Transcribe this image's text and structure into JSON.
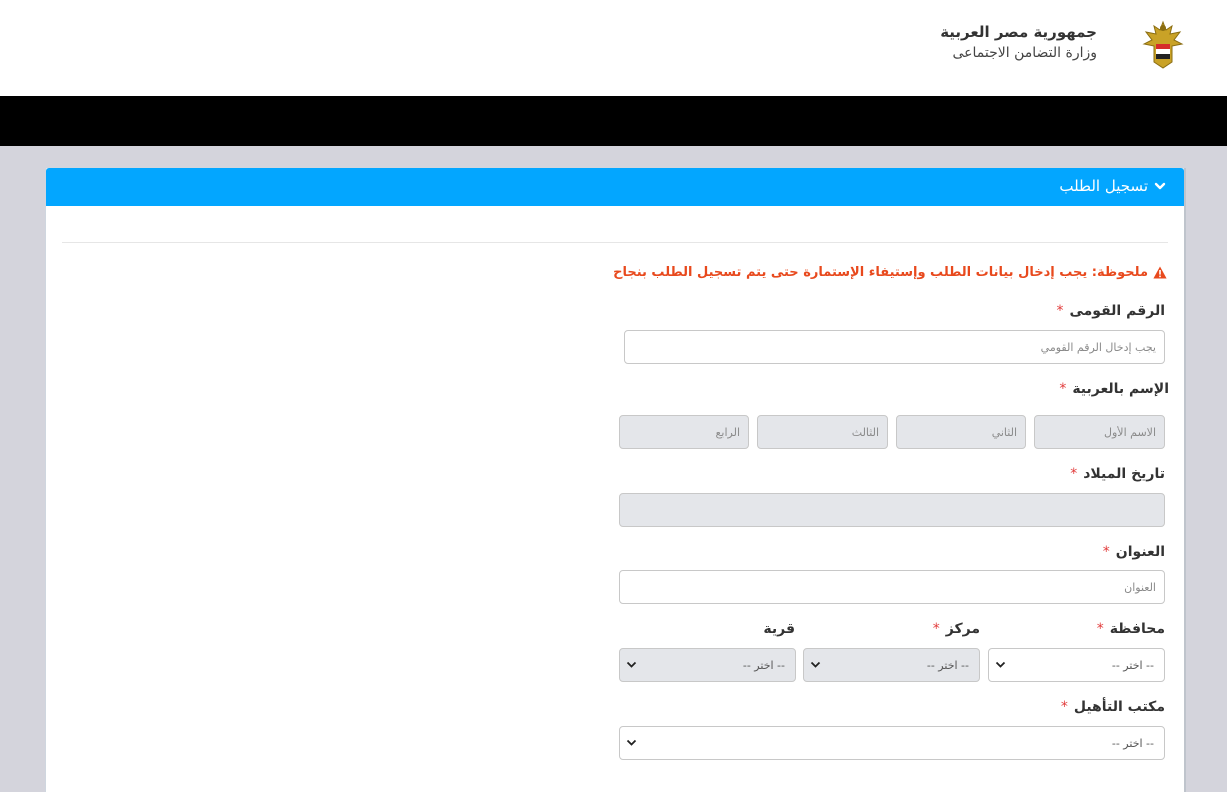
{
  "header": {
    "title": "جمهورية مصر العربية",
    "subtitle": "وزارة التضامن الاجتماعى",
    "emblem_icon": "eagle-emblem-icon"
  },
  "panel": {
    "title": "تسجيل الطلب",
    "heading_color": "#03a6ff",
    "toggle_icon": "chevron-down-icon"
  },
  "note": {
    "text": "ملحوظة: يجب إدخال بيانات الطلب وإستيفاء الإستمارة حتى يتم تسجيل الطلب بنجاح",
    "icon": "warning-icon",
    "color": "#e8491d"
  },
  "form": {
    "required_mark": "*",
    "national_id": {
      "label": "الرقم القومى",
      "placeholder": "يجب إدخال الرقم القومي",
      "value": ""
    },
    "arabic_name": {
      "label": "الإسم بالعربية",
      "first": {
        "placeholder": "الاسم الأول"
      },
      "second": {
        "placeholder": "الثاني"
      },
      "third": {
        "placeholder": "الثالث"
      },
      "fourth": {
        "placeholder": "الرابع"
      }
    },
    "birth_date": {
      "label": "تاريخ الميلاد",
      "value": ""
    },
    "address": {
      "label": "العنوان",
      "placeholder": "العنوان",
      "value": ""
    },
    "governorate": {
      "label": "محافظة",
      "selected": "-- اختر --"
    },
    "district": {
      "label": "مركز",
      "selected": "-- اختر --"
    },
    "village": {
      "label": "قرية",
      "selected": "-- اختر --"
    },
    "rehab_office": {
      "label": "مكتب التأهيل",
      "selected": "-- اختر --"
    }
  }
}
